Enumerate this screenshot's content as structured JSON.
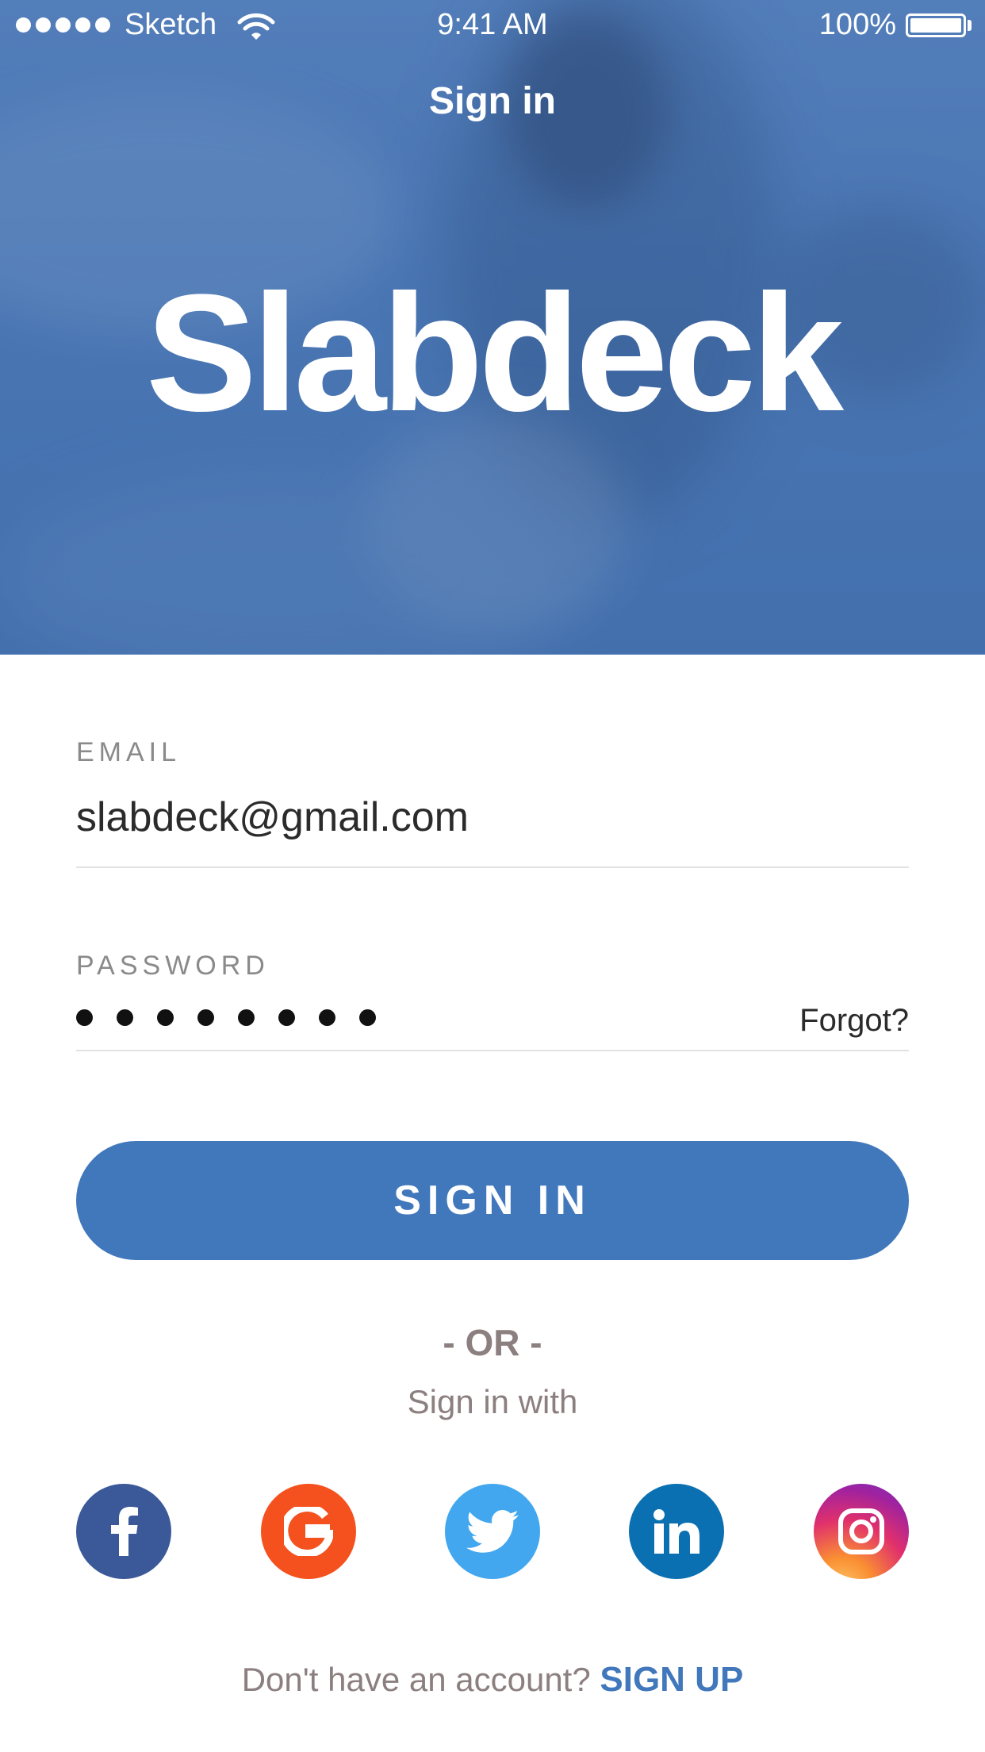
{
  "status_bar": {
    "carrier": "Sketch",
    "time": "9:41 AM",
    "battery": "100%"
  },
  "header": {
    "title": "Sign in",
    "logo_text": "Slabdeck"
  },
  "form": {
    "email_label": "EMAIL",
    "email_value": "slabdeck@gmail.com",
    "password_label": "PASSWORD",
    "password_length": 8,
    "forgot_label": "Forgot?",
    "signin_button": "SIGN IN"
  },
  "alt_signin": {
    "or_text": "- OR -",
    "sign_in_with": "Sign in with",
    "providers": [
      {
        "name": "facebook",
        "icon": "facebook-icon",
        "color": "#3b5998"
      },
      {
        "name": "google",
        "icon": "google-icon",
        "color": "#f4511e"
      },
      {
        "name": "twitter",
        "icon": "twitter-icon",
        "color": "#42a7ee"
      },
      {
        "name": "linkedin",
        "icon": "linkedin-icon",
        "color": "#0b70b1"
      },
      {
        "name": "instagram",
        "icon": "instagram-icon",
        "color": "#c13584"
      }
    ]
  },
  "footer": {
    "prompt": "Don't have an account?",
    "signup_link": "SIGN UP"
  },
  "colors": {
    "accent": "#4178bc",
    "hero_tint": "#4f7bb6",
    "muted_text": "#8c7f7f"
  }
}
